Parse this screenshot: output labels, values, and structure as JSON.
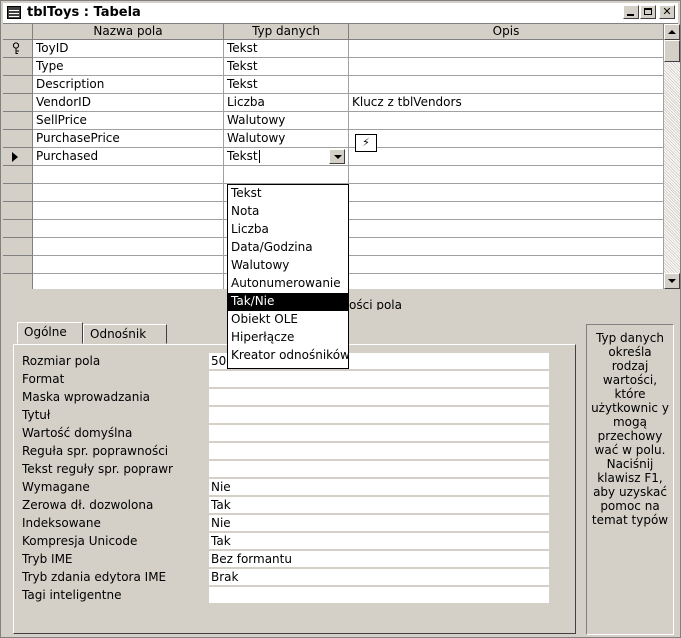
{
  "window": {
    "title": "tblToys : Tabela"
  },
  "grid": {
    "headers": [
      "Nazwa pola",
      "Typ danych",
      "Opis"
    ],
    "rows": [
      {
        "name": "ToyID",
        "type": "Tekst",
        "desc": ""
      },
      {
        "name": "Type",
        "type": "Tekst",
        "desc": ""
      },
      {
        "name": "Description",
        "type": "Tekst",
        "desc": ""
      },
      {
        "name": "VendorID",
        "type": "Liczba",
        "desc": "Klucz z tblVendors"
      },
      {
        "name": "SellPrice",
        "type": "Walutowy",
        "desc": ""
      },
      {
        "name": "PurchasePrice",
        "type": "Walutowy",
        "desc": ""
      },
      {
        "name": "Purchased",
        "type": "Tekst",
        "desc": ""
      }
    ],
    "empty_rows": 6
  },
  "dropdown": {
    "options": [
      "Tekst",
      "Nota",
      "Liczba",
      "Data/Godzina",
      "Walutowy",
      "Autonumerowanie",
      "Tak/Nie",
      "Obiekt OLE",
      "Hiperłącze",
      "Kreator odnośników"
    ],
    "highlighted": "Tak/Nie"
  },
  "properties_caption": "ości pola",
  "tabs": {
    "general": "Ogólne",
    "lookup": "Odnośnik"
  },
  "properties": [
    {
      "label": "Rozmiar pola",
      "value": "50"
    },
    {
      "label": "Format",
      "value": ""
    },
    {
      "label": "Maska wprowadzania",
      "value": ""
    },
    {
      "label": "Tytuł",
      "value": ""
    },
    {
      "label": "Wartość domyślna",
      "value": ""
    },
    {
      "label": "Reguła spr. poprawności",
      "value": ""
    },
    {
      "label": "Tekst reguły spr. poprawr",
      "value": ""
    },
    {
      "label": "Wymagane",
      "value": "Nie"
    },
    {
      "label": "Zerowa dł. dozwolona",
      "value": "Tak"
    },
    {
      "label": "Indeksowane",
      "value": "Nie"
    },
    {
      "label": "Kompresja Unicode",
      "value": "Tak"
    },
    {
      "label": "Tryb IME",
      "value": "Bez formantu"
    },
    {
      "label": "Tryb zdania edytora IME",
      "value": "Brak"
    },
    {
      "label": "Tagi inteligentne",
      "value": ""
    }
  ],
  "help_text": "Typ danych określa rodzaj wartości, które użytkownic y mogą przechowy wać w polu. Naciśnij klawisz F1, aby uzyskać pomoc na temat typów",
  "icons": {
    "app": "table-icon",
    "primary_key": "key-icon",
    "current_row": "row-pointer-icon",
    "builder": "builder-icon"
  }
}
